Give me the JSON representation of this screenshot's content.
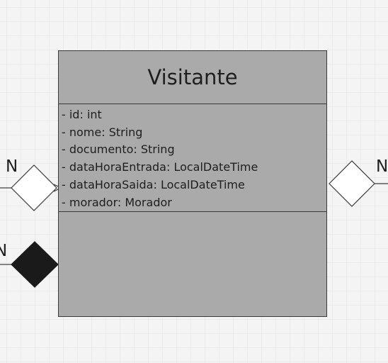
{
  "diagram": {
    "class_name": "Visitante",
    "attributes": [
      "- id: int",
      "- nome: String",
      "- documento: String",
      "- dataHoraEntrada: LocalDateTime",
      "- dataHoraSaida: LocalDateTime",
      "- morador: Morador"
    ],
    "methods": [],
    "relations": [
      {
        "side": "left",
        "type": "aggregation",
        "multiplicity": "N",
        "fill": "#ffffff"
      },
      {
        "side": "left",
        "type": "composition",
        "multiplicity": "N",
        "fill": "#1a1a1a"
      },
      {
        "side": "right",
        "type": "aggregation",
        "multiplicity": "N",
        "fill": "#ffffff"
      }
    ]
  },
  "colors": {
    "class_fill": "#aaaaaa",
    "border": "#3a3a3a",
    "background": "#f4f4f4"
  }
}
